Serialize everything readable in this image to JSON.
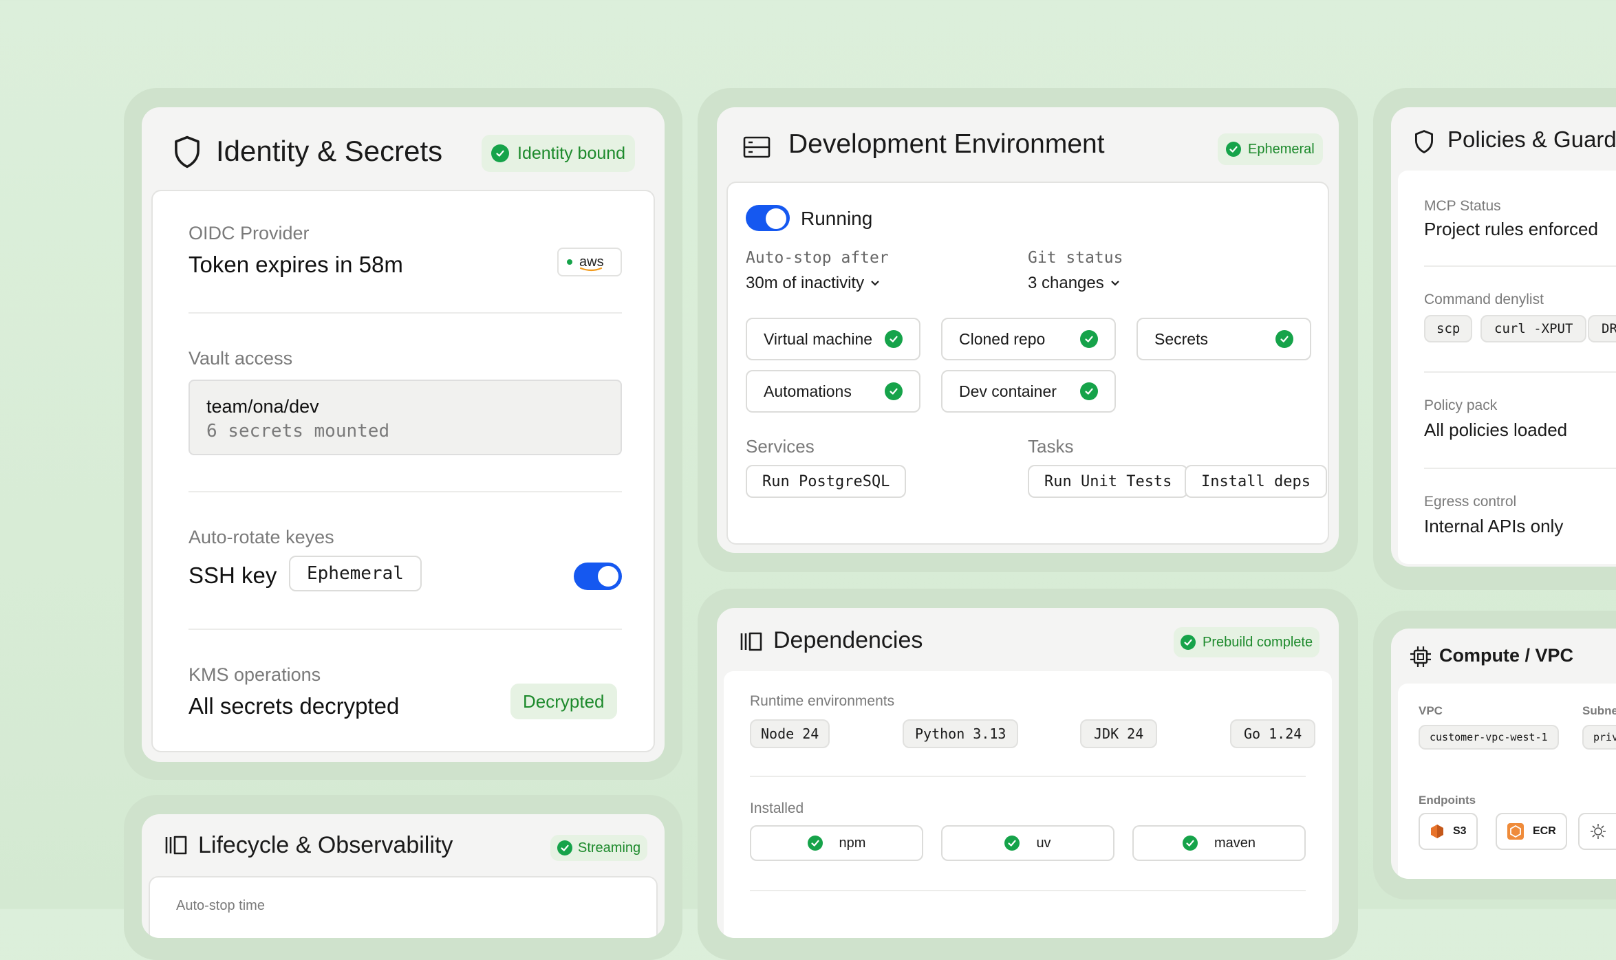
{
  "colors": {
    "accent": "#1558f0",
    "success": "#16a34a",
    "success_bg": "#e6f2e3",
    "background": "#dcefdb"
  },
  "identity": {
    "title": "Identity & Secrets",
    "badge": "Identity bound",
    "oidc_label": "OIDC Provider",
    "oidc_value": "Token expires in 58m",
    "oidc_logo": "aws",
    "vault_label": "Vault access",
    "vault_path": "team/ona/dev",
    "vault_detail": "6 secrets mounted",
    "rotate_label": "Auto-rotate keyes",
    "rotate_value": "SSH key",
    "rotate_tag": "Ephemeral",
    "rotate_enabled": true,
    "kms_label": "KMS operations",
    "kms_value": "All secrets decrypted",
    "kms_badge": "Decrypted"
  },
  "lifecycle": {
    "title": "Lifecycle & Observability",
    "badge": "Streaming",
    "first_label": "Auto-stop time"
  },
  "devenv": {
    "title": "Development Environment",
    "badge": "Ephemeral",
    "status": "Running",
    "running": true,
    "autostop_label": "Auto-stop after",
    "autostop_value": "30m of inactivity",
    "git_label": "Git status",
    "git_value": "3 changes",
    "checks": [
      "Virtual machine",
      "Cloned repo",
      "Secrets",
      "Automations",
      "Dev container"
    ],
    "services_label": "Services",
    "services": [
      "Run PostgreSQL"
    ],
    "tasks_label": "Tasks",
    "tasks": [
      "Run Unit Tests",
      "Install deps"
    ]
  },
  "deps": {
    "title": "Dependencies",
    "badge": "Prebuild complete",
    "runtime_label": "Runtime environments",
    "runtimes": [
      "Node 24",
      "Python 3.13",
      "JDK 24",
      "Go 1.24"
    ],
    "installed_label": "Installed",
    "installed": [
      "npm",
      "uv",
      "maven"
    ]
  },
  "policies": {
    "title": "Policies & Guardr",
    "mcp_label": "MCP Status",
    "mcp_value": "Project rules enforced",
    "denylist_label": "Command denylist",
    "denylist": [
      "scp",
      "curl -XPUT",
      "DR"
    ],
    "pack_label": "Policy pack",
    "pack_value": "All policies loaded",
    "egress_label": "Egress control",
    "egress_value": "Internal APIs only"
  },
  "compute": {
    "title": "Compute / VPC",
    "vpc_label": "VPC",
    "vpc_value": "customer-vpc-west-1",
    "subnet_label": "Subne",
    "subnet_value": "priv",
    "endpoints_label": "Endpoints",
    "endpoints": [
      "S3",
      "ECR"
    ]
  }
}
